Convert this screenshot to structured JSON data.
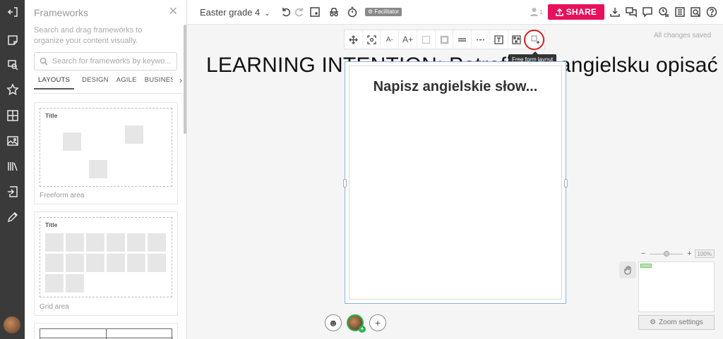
{
  "frameworks_panel": {
    "title": "Frameworks",
    "description": "Search and drag frameworks to organize your content visually.",
    "search_placeholder": "Search for frameworks by keywo...",
    "tabs": [
      {
        "label": "LAYOUTS",
        "active": true
      },
      {
        "label": "DESIGN",
        "active": false
      },
      {
        "label": "AGILE",
        "active": false
      },
      {
        "label": "BUSINESS",
        "active": false
      }
    ],
    "cards": [
      {
        "title": "Title",
        "caption": "Freeform area"
      },
      {
        "title": "Title",
        "caption": "Grid area"
      }
    ]
  },
  "topbar": {
    "board_title": "Easter grade 4",
    "facilitator_badge": "Facilitator",
    "user_count": "1",
    "share_label": "SHARE"
  },
  "toolbar": {
    "font_decrease": "A-",
    "font_increase": "A+",
    "tooltip": "Free form layout"
  },
  "status": {
    "saved": "All changes saved"
  },
  "canvas": {
    "intention_text": "LEARNING INTENTION: Potrafię po angielsku opisać",
    "frame_heading": "Napisz angielskie słow..."
  },
  "zoom": {
    "minus": "−",
    "plus": "+",
    "percent": "100%",
    "settings_label": "Zoom settings"
  },
  "colors": {
    "accent": "#e8115b",
    "selection": "#8ab4e8",
    "highlight": "#d62020",
    "rail": "#3a3a3a"
  }
}
